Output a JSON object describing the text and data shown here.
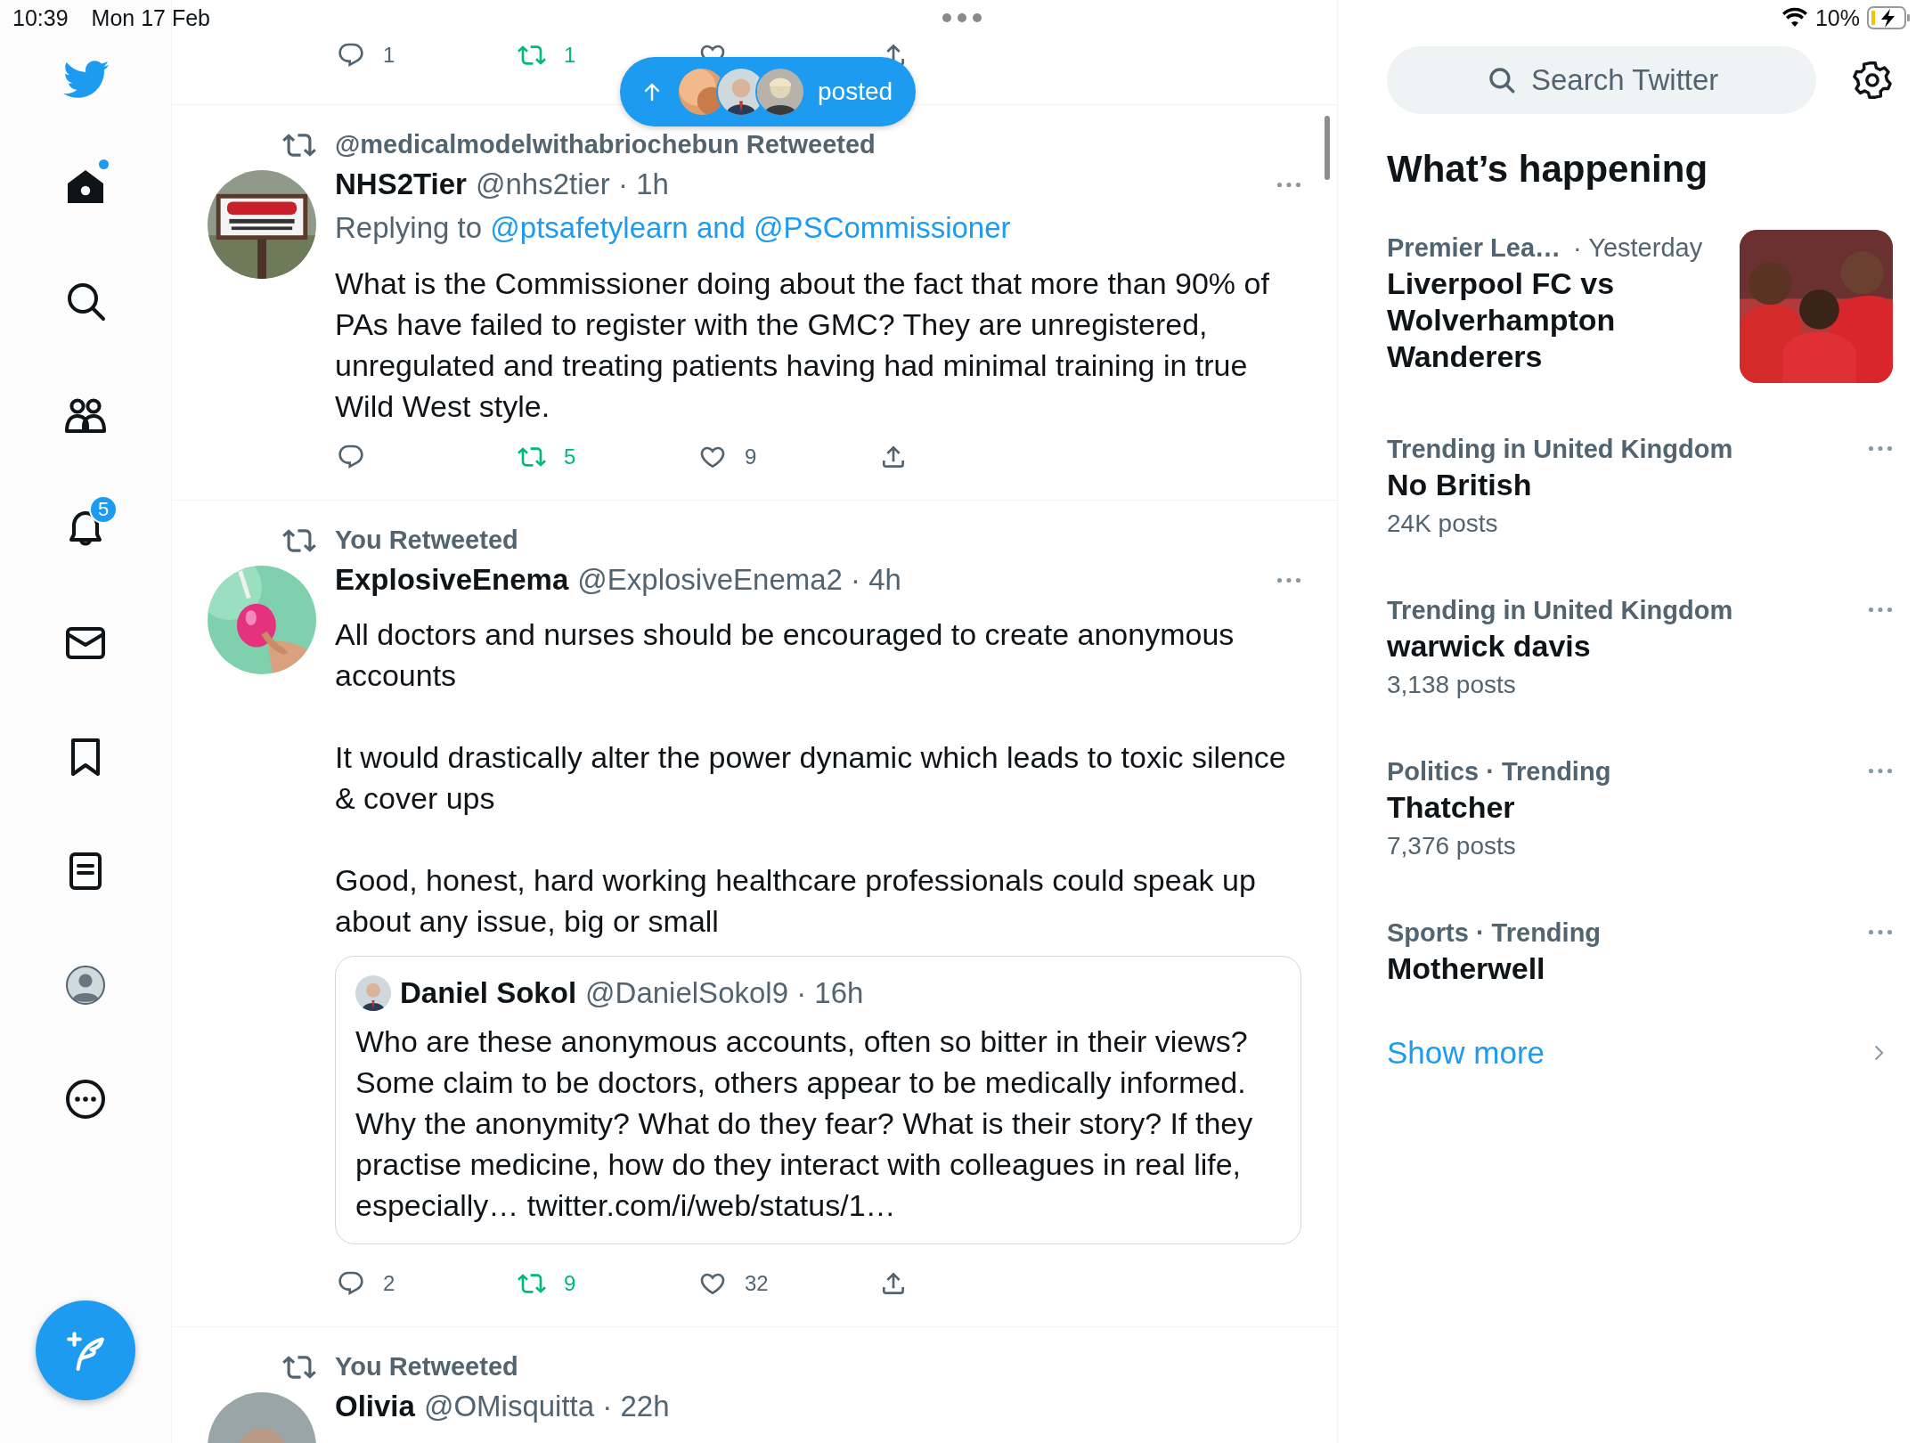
{
  "status_bar": {
    "time": "10:39",
    "date": "Mon 17 Feb",
    "battery": "10%"
  },
  "nav": {
    "items": [
      {
        "kind": "home",
        "selected": true,
        "unread": true
      },
      {
        "kind": "explore",
        "selected": false,
        "unread": false
      },
      {
        "kind": "communities",
        "selected": false,
        "unread": false
      },
      {
        "kind": "notifications",
        "selected": false,
        "unread": false,
        "badge": "5"
      },
      {
        "kind": "messages",
        "selected": false,
        "unread": false
      },
      {
        "kind": "bookmarks",
        "selected": false,
        "unread": false
      },
      {
        "kind": "lists",
        "selected": false,
        "unread": false
      },
      {
        "kind": "profile",
        "selected": false,
        "unread": false
      },
      {
        "kind": "more",
        "selected": false,
        "unread": false
      }
    ]
  },
  "previous_tweet": {
    "actions": [
      {
        "kind": "reply",
        "count": "1",
        "active": false
      },
      {
        "kind": "retweet",
        "count": "1",
        "active": true
      },
      {
        "kind": "like",
        "active": false
      },
      {
        "kind": "share",
        "active": false
      }
    ]
  },
  "new_posts_pill": {
    "label": "posted"
  },
  "tweets": [
    {
      "context": "@medicalmodelwithabriochebun Retweeted",
      "name": "NHS2Tier",
      "handle": "@nhs2tier · 1h",
      "replying_prefix": "Replying to",
      "replying_to": "@ptsafetylearn and @PSCommissioner",
      "paragraphs": [
        "What is the Commissioner doing about the fact that more than 90% of PAs have failed to register with the GMC? They are unregistered, unregulated and treating patients having had minimal training in true Wild West style."
      ],
      "actions": [
        {
          "kind": "reply",
          "active": false
        },
        {
          "kind": "retweet",
          "count": "5",
          "active": true
        },
        {
          "kind": "like",
          "count": "9",
          "active": false
        },
        {
          "kind": "share",
          "active": false
        }
      ]
    },
    {
      "context": "You Retweeted",
      "name": "ExplosiveEnema",
      "handle": "@ExplosiveEnema2 · 4h",
      "paragraphs": [
        "All doctors and nurses should be encouraged to create anonymous accounts",
        "It would drastically alter the power dynamic which leads to toxic silence & cover ups",
        "Good, honest, hard working healthcare professionals could speak up about any issue, big or small"
      ],
      "quote": {
        "name": "Daniel Sokol",
        "handle": "@DanielSokol9 · 16h",
        "text": "Who are these anonymous accounts, often so bitter in their views? Some claim to be doctors, others appear to be medically informed. Why the anonymity? What do they fear? What is their story? If they practise medicine, how do they interact with colleagues in real life, especially… twitter.com/i/web/status/1…"
      },
      "actions": [
        {
          "kind": "reply",
          "count": "2",
          "active": false
        },
        {
          "kind": "retweet",
          "count": "9",
          "active": true
        },
        {
          "kind": "like",
          "count": "32",
          "active": false
        },
        {
          "kind": "share",
          "active": false
        }
      ]
    },
    {
      "context": "You Retweeted",
      "name": "Olivia",
      "handle": "@OMisquitta · 22h"
    }
  ],
  "sidebar": {
    "search": {
      "placeholder": "Search Twitter"
    },
    "heading": "What’s happening",
    "trends": [
      {
        "context": "Premier Lea…",
        "meta": "· Yesterday",
        "title": "Liverpool FC vs Wolverhampton Wanderers",
        "kind": "picture"
      },
      {
        "context": "Trending in United Kingdom",
        "title": "No British",
        "posts": "24K posts"
      },
      {
        "context": "Trending in United Kingdom",
        "title": "warwick davis",
        "posts": "3,138 posts"
      },
      {
        "context": "Politics · Trending",
        "title": "Thatcher",
        "posts": "7,376 posts"
      },
      {
        "context": "Sports · Trending",
        "title": "Motherwell"
      }
    ],
    "show_more": "Show more"
  }
}
